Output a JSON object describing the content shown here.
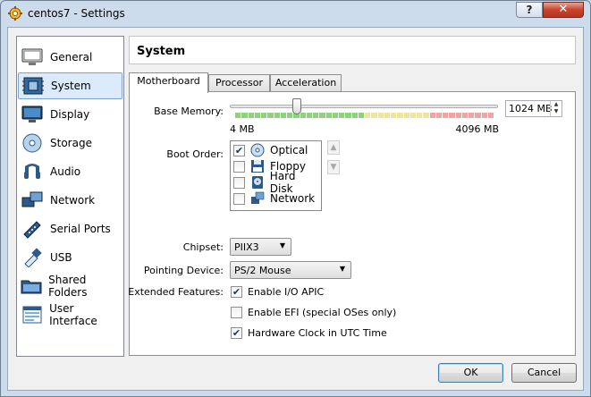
{
  "window": {
    "title": "centos7 - Settings",
    "help_label": "?",
    "close_label": "✕"
  },
  "sidebar": {
    "items": [
      {
        "label": "General",
        "icon": "general-icon"
      },
      {
        "label": "System",
        "icon": "system-icon",
        "selected": true
      },
      {
        "label": "Display",
        "icon": "display-icon"
      },
      {
        "label": "Storage",
        "icon": "storage-icon"
      },
      {
        "label": "Audio",
        "icon": "audio-icon"
      },
      {
        "label": "Network",
        "icon": "network-icon"
      },
      {
        "label": "Serial Ports",
        "icon": "serial-ports-icon"
      },
      {
        "label": "USB",
        "icon": "usb-icon"
      },
      {
        "label": "Shared Folders",
        "icon": "shared-folders-icon"
      },
      {
        "label": "User Interface",
        "icon": "user-interface-icon"
      }
    ]
  },
  "header": {
    "title": "System"
  },
  "tabs": [
    {
      "label": "Motherboard",
      "active": true
    },
    {
      "label": "Processor"
    },
    {
      "label": "Acceleration"
    }
  ],
  "motherboard": {
    "base_memory_label": "Base Memory:",
    "memory_value": "1024 MB",
    "memory_min": "4 MB",
    "memory_max": "4096 MB",
    "slider_fraction": 0.25,
    "boot_order_label": "Boot Order:",
    "boot_items": [
      {
        "label": "Optical",
        "checked": true,
        "icon": "optical-disc-icon"
      },
      {
        "label": "Floppy",
        "checked": false,
        "icon": "floppy-icon"
      },
      {
        "label": "Hard Disk",
        "checked": false,
        "icon": "hard-disk-icon"
      },
      {
        "label": "Network",
        "checked": false,
        "icon": "network-icon"
      }
    ],
    "chipset_label": "Chipset:",
    "chipset_value": "PIIX3",
    "pointing_label": "Pointing Device:",
    "pointing_value": "PS/2 Mouse",
    "extended_label": "Extended Features:",
    "features": [
      {
        "label": "Enable I/O APIC",
        "checked": true
      },
      {
        "label": "Enable EFI (special OSes only)",
        "checked": false
      },
      {
        "label": "Hardware Clock in UTC Time",
        "checked": true
      }
    ]
  },
  "buttons": {
    "ok": "OK",
    "cancel": "Cancel"
  },
  "colors": {
    "accent": "#3c7fb1",
    "selection": "#dcebfc",
    "slider_green": "#8ed27b",
    "slider_yellow": "#f1e59a",
    "slider_red": "#eea5a3"
  }
}
